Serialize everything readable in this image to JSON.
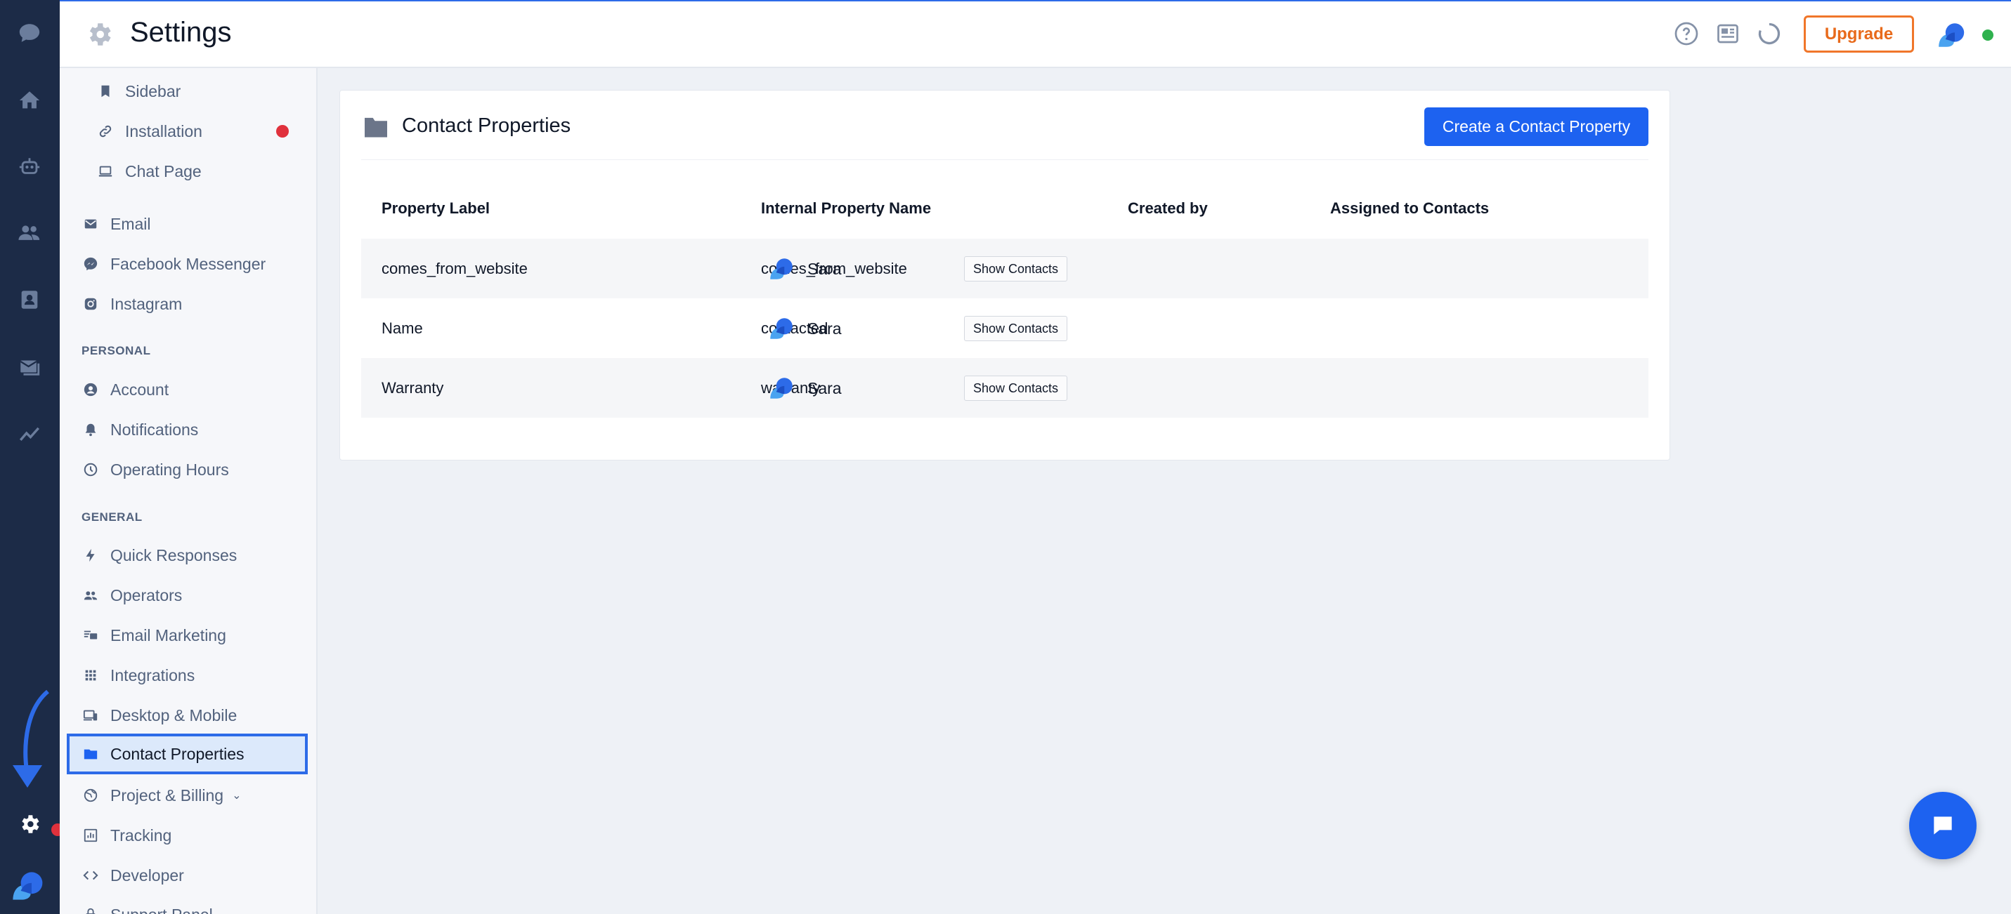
{
  "header": {
    "title": "Settings",
    "upgrade_label": "Upgrade",
    "icons": [
      "help-icon",
      "news-icon",
      "loading-icon"
    ]
  },
  "rail": {
    "icons": [
      "chat-icon",
      "home-icon",
      "bot-icon",
      "people-icon",
      "contacts-icon",
      "inbox-icon",
      "analytics-icon",
      "settings-icon"
    ]
  },
  "sidebar": {
    "top_items": [
      {
        "label": "Sidebar",
        "icon": "bookmark-icon"
      },
      {
        "label": "Installation",
        "icon": "link-icon"
      },
      {
        "label": "Chat Page",
        "icon": "laptop-icon"
      }
    ],
    "channel_items": [
      {
        "label": "Email",
        "icon": "mail-icon"
      },
      {
        "label": "Facebook Messenger",
        "icon": "messenger-icon"
      },
      {
        "label": "Instagram",
        "icon": "instagram-icon"
      }
    ],
    "personal_heading": "PERSONAL",
    "personal_items": [
      {
        "label": "Account",
        "icon": "account-icon"
      },
      {
        "label": "Notifications",
        "icon": "bell-icon"
      },
      {
        "label": "Operating Hours",
        "icon": "clock-icon"
      }
    ],
    "general_heading": "GENERAL",
    "general_items": [
      {
        "label": "Quick Responses",
        "icon": "bolt-icon"
      },
      {
        "label": "Operators",
        "icon": "operators-icon"
      },
      {
        "label": "Email Marketing",
        "icon": "email-marketing-icon"
      },
      {
        "label": "Integrations",
        "icon": "grid-icon"
      },
      {
        "label": "Desktop & Mobile",
        "icon": "devices-icon"
      },
      {
        "label": "Contact Properties",
        "icon": "folder-icon"
      },
      {
        "label": "Project & Billing",
        "icon": "globe-icon"
      },
      {
        "label": "Tracking",
        "icon": "chart-icon"
      },
      {
        "label": "Developer",
        "icon": "code-icon"
      },
      {
        "label": "Support Panel",
        "icon": "lock-icon"
      }
    ]
  },
  "main": {
    "title": "Contact Properties",
    "create_label": "Create a Contact Property",
    "columns": [
      "Property Label",
      "Internal Property Name",
      "Created by",
      "Assigned to Contacts"
    ],
    "rows": [
      {
        "label": "comes_from_website",
        "internal": "comes_from_website",
        "created_by": "Sara",
        "action": "Show Contacts"
      },
      {
        "label": "Name",
        "internal": "contacted",
        "created_by": "Sara",
        "action": "Show Contacts"
      },
      {
        "label": "Warranty",
        "internal": "warranty",
        "created_by": "Sara",
        "action": "Show Contacts"
      }
    ]
  },
  "colors": {
    "accent": "#1d62f0",
    "rail": "#1c2b47",
    "upgrade": "#f0762a",
    "alert": "#e0313c",
    "online": "#2fb14e"
  }
}
